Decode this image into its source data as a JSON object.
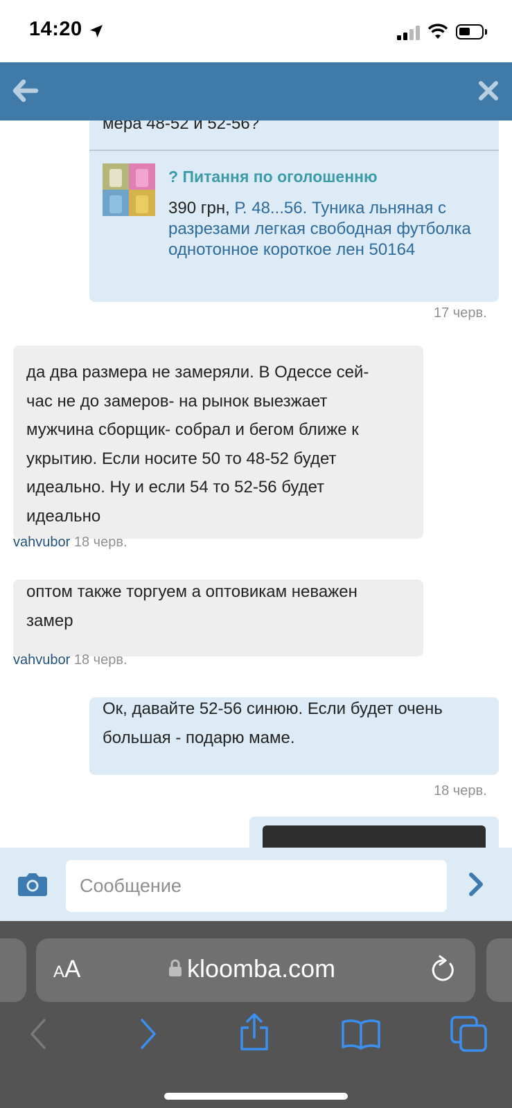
{
  "status_bar": {
    "time": "14:20"
  },
  "app_bar": {
    "back_icon": "arrow-left-icon",
    "close_icon": "close-icon"
  },
  "messages": {
    "m1": {
      "partial_text": "мера 48-52 и 52-56?",
      "ad_heading": "? Питання по оголошенню",
      "ad_price": "390 грн, ",
      "ad_title": "Р. 48...56. Туника льняная с разрезами легкая свободная футболка однотонное короткое лен 50164",
      "date": "17 черв."
    },
    "m2": {
      "text_lines": [
        "да два размера не замеряли. В Одессе сей-",
        "час не до замеров- на рынок выезжает",
        "мужчина сборщик- собрал и бегом ближе к",
        "укрытию. Если носите 50 то 48-52 будет",
        "идеально. Ну и если 54 то 52-56 будет",
        "идеально"
      ],
      "author": "vahvubor",
      "date": "18 черв."
    },
    "m3": {
      "text_lines": [
        "оптом также торгуем а оптовикам неважен",
        "замер"
      ],
      "author": "vahvubor",
      "date": "18 черв."
    },
    "m4": {
      "text_lines": [
        "Ок, давайте 52-56 синюю. Если будет очень",
        "большая - подарю маме."
      ],
      "date": "18 черв."
    }
  },
  "input": {
    "placeholder": "Сообщение",
    "value": ""
  },
  "safari": {
    "aa_label_small": "A",
    "aa_label_big": "A",
    "url": "kloomba.com"
  },
  "colors": {
    "header": "#407aa8",
    "bubble_out": "#dcebf5",
    "bubble_in": "#eeeeee",
    "link": "#2f6a9c",
    "accent": "#3d9aa8"
  }
}
